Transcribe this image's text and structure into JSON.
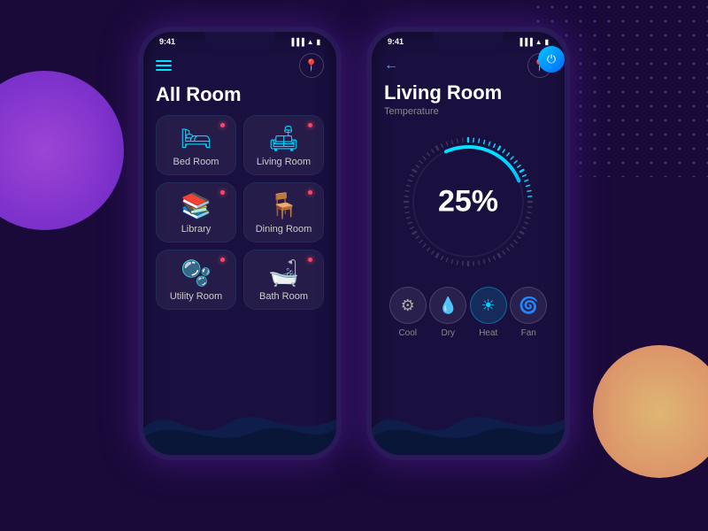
{
  "background": {
    "color": "#1a0a3a"
  },
  "phone1": {
    "status_time": "9:41",
    "title": "All Room",
    "rooms": [
      {
        "name": "Bed Room",
        "icon": "🛏",
        "active": true
      },
      {
        "name": "Living Room",
        "icon": "🛋",
        "active": false
      },
      {
        "name": "Library",
        "icon": "📚",
        "active": false
      },
      {
        "name": "Dining Room",
        "icon": "🪑",
        "active": false
      },
      {
        "name": "Utility Room",
        "icon": "🫧",
        "active": false
      },
      {
        "name": "Bath Room",
        "icon": "🛁",
        "active": false
      }
    ]
  },
  "phone2": {
    "status_time": "9:41",
    "title": "Living Room",
    "temperature_label": "Temperature",
    "gauge_value": "25%",
    "controls": [
      {
        "name": "Cool",
        "icon": "⚙",
        "active": false
      },
      {
        "name": "Dry",
        "icon": "💧",
        "active": false
      },
      {
        "name": "Heat",
        "icon": "☀",
        "active": true
      },
      {
        "name": "Fan",
        "icon": "🌀",
        "active": false
      }
    ]
  }
}
